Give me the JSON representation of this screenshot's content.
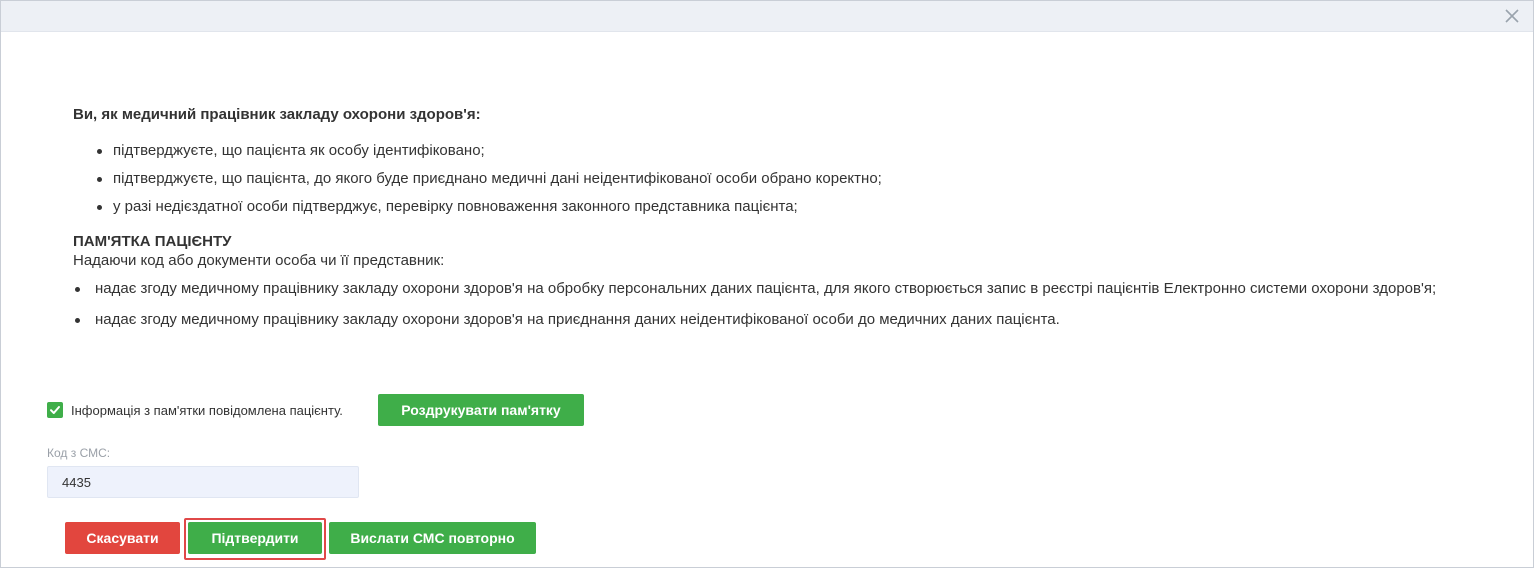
{
  "dialog": {
    "close_icon": "close-icon"
  },
  "intro": {
    "title": "Ви, як медичний працівник закладу охорони здоров'я:",
    "items": [
      "підтверджуєте, що пацієнта як особу ідентифіковано;",
      "підтверджуєте, що пацієнта, до якого буде приєднано медичні дані неідентифікованої особи обрано коректно;",
      "у разі недієздатної особи підтверджує, перевірку повноваження законного представника пацієнта;"
    ]
  },
  "memo": {
    "title": "ПАМ'ЯТКА ПАЦІЄНТУ",
    "intro": "Надаючи код або документи особа чи її представник:",
    "items": [
      "надає згоду медичному працівнику закладу охорони здоров'я на обробку персональних даних пацієнта, для якого створюється запис в реєстрі пацієнтів Електронно системи охорони здоров'я;",
      "надає згоду медичному працівнику закладу охорони здоров'я на приєднання даних неідентифікованої особи до медичних даних пацієнта."
    ]
  },
  "acknowledge": {
    "checked": true,
    "label": "Інформація з пам'ятки повідомлена пацієнту."
  },
  "print_button": "Роздрукувати пам'ятку",
  "sms": {
    "label": "Код з СМС:",
    "value": "4435"
  },
  "actions": {
    "cancel": "Скасувати",
    "confirm": "Підтвердити",
    "resend": "Вислати СМС повторно"
  },
  "colors": {
    "green": "#3fae49",
    "red": "#e2463e",
    "highlight": "#e04848",
    "header": "#edf0f5"
  }
}
